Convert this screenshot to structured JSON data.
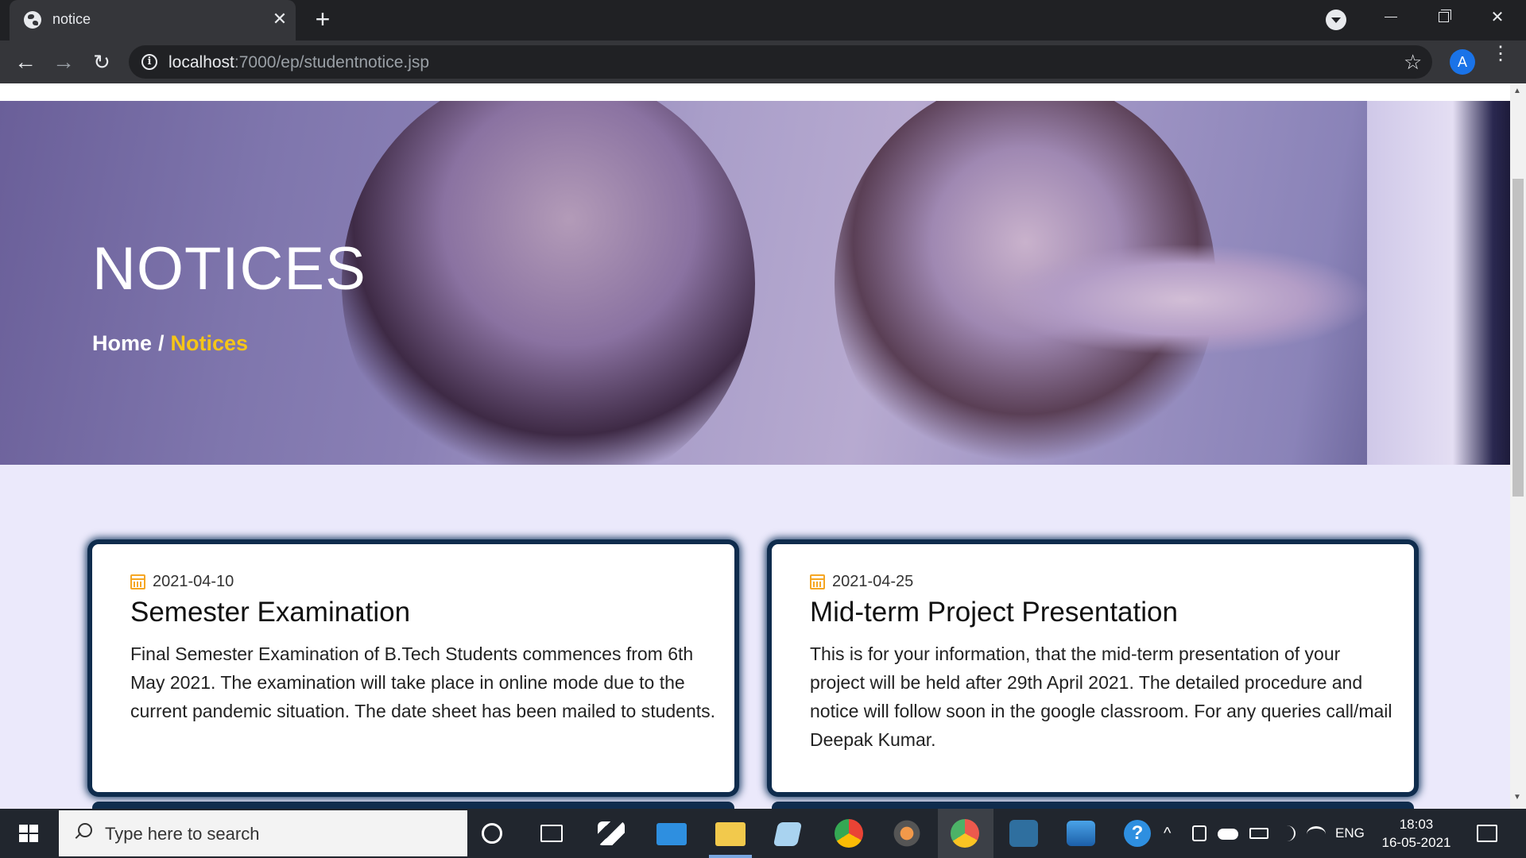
{
  "browser": {
    "tab_title": "notice",
    "tab_close": "✕",
    "new_tab": "+",
    "url_host": "localhost",
    "url_path": ":7000/ep/studentnotice.jsp",
    "profile_initial": "A",
    "back_glyph": "←",
    "forward_glyph": "→",
    "reload_glyph": "↻",
    "star_glyph": "☆",
    "menu_glyph": "⋮",
    "close_glyph": "✕"
  },
  "hero": {
    "title": "NOTICES",
    "breadcrumb_home": "Home",
    "breadcrumb_sep": "/",
    "breadcrumb_current": "Notices"
  },
  "notices": [
    {
      "date": "2021-04-10",
      "title": "Semester Examination",
      "body": "Final Semester Examination of B.Tech Students commences from 6th May 2021. The examination will take place in online mode due to the current pandemic situation. The date sheet has been mailed to students."
    },
    {
      "date": "2021-04-25",
      "title": "Mid-term Project Presentation",
      "body": "This is for your information, that the mid-term presentation of your project will be held after 29th April 2021. The detailed procedure and notice will follow soon in the google classroom. For any queries call/mail Deepak Kumar."
    }
  ],
  "taskbar": {
    "search_placeholder": "Type here to search",
    "tray_chevron": "^",
    "language": "ENG",
    "time": "18:03",
    "date": "16-05-2021"
  },
  "colors": {
    "accent": "#f5c518",
    "card_border": "#0f2c4d",
    "page_bg": "#ebe9fb"
  }
}
